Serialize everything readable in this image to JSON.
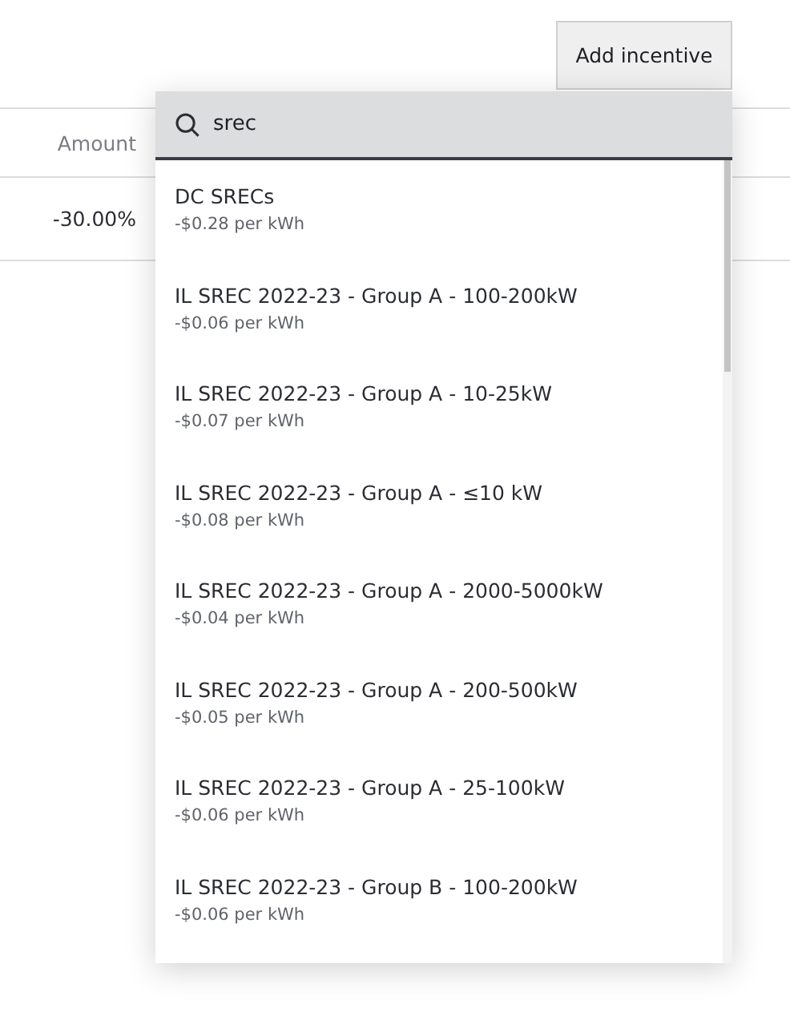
{
  "add_button": {
    "label": "Add incentive"
  },
  "table": {
    "columns": [
      "Amount"
    ],
    "rows": [
      {
        "amount": "-30.00%"
      }
    ]
  },
  "dropdown": {
    "search": {
      "value": "srec"
    },
    "options": [
      {
        "title": "DC SRECs",
        "rate": "-$0.28 per kWh"
      },
      {
        "title": "IL SREC 2022-23 - Group A - 100-200kW",
        "rate": "-$0.06 per kWh"
      },
      {
        "title": "IL SREC 2022-23 - Group A - 10-25kW",
        "rate": "-$0.07 per kWh"
      },
      {
        "title": "IL SREC 2022-23 - Group A - ≤10 kW",
        "rate": "-$0.08 per kWh"
      },
      {
        "title": "IL SREC 2022-23 - Group A - 2000-5000kW",
        "rate": "-$0.04 per kWh"
      },
      {
        "title": "IL SREC 2022-23 - Group A - 200-500kW",
        "rate": "-$0.05 per kWh"
      },
      {
        "title": "IL SREC 2022-23 - Group A - 25-100kW",
        "rate": "-$0.06 per kWh"
      },
      {
        "title": "IL SREC 2022-23 - Group B - 100-200kW",
        "rate": "-$0.06 per kWh"
      }
    ]
  }
}
